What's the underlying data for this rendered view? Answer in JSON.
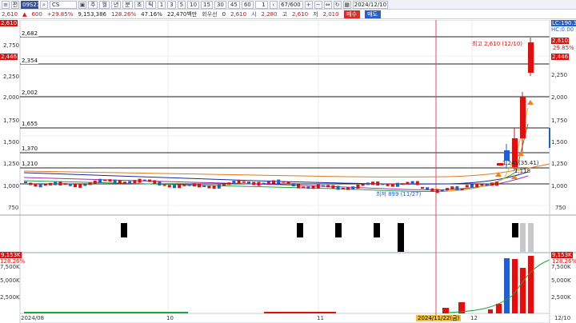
{
  "toolbar": {
    "code": "09S270",
    "name": "CS",
    "period_buttons": [
      "주",
      "월",
      "년",
      "분",
      "초",
      "틱"
    ],
    "interval_buttons": [
      "1",
      "3",
      "5",
      "10",
      "15",
      "30",
      "45",
      "60"
    ],
    "count_value": "1",
    "range_value": "67/600",
    "date_value": "2024/12/10"
  },
  "quote": {
    "price": "2,610",
    "change": "600",
    "change_pct": "+29.85%",
    "volume": "9,153,386",
    "vol_ratio": "128.26%",
    "turnover": "47.16%",
    "value_text": "22,470백만",
    "pref_label": "회우선",
    "pref_value": "0",
    "open_price": "2,610",
    "open_label": "시",
    "open_value": "2,280",
    "high_label": "고",
    "high_value": "2,610",
    "low_label": "저",
    "low_value": "2,010",
    "buy_label": "매수",
    "sell_label": "매도"
  },
  "price_levels": [
    "2,682",
    "2,354",
    "2,002",
    "1,655",
    "1,370",
    "1,210"
  ],
  "y_ticks": [
    "2,750",
    "2,500",
    "2,250",
    "2,000",
    "1,750",
    "1,500",
    "1,250",
    "1,000",
    "750"
  ],
  "volume_ticks": [
    "7,500K",
    "5,000K",
    "2,500K"
  ],
  "x_labels": [
    "2024/08",
    "10",
    "11",
    "12",
    "12/10"
  ],
  "marker_date": "2024/11/22(금)",
  "annotations": {
    "high": "최고 2,610 (12/10)",
    "low": "최저 899 (11/27)",
    "mid": "1,241(35.41)",
    "mid2": "1,118"
  },
  "right_badges": {
    "price": "2,610",
    "pct": "29.85%",
    "ma": "2,446",
    "lc": "LC:190.32",
    "hc": "HC:0.00",
    "vol": "9,153K",
    "vol_pct": "128.26%"
  },
  "colors": {
    "up": "#e01010",
    "down": "#1f5fd0",
    "buy": "#e02a2a",
    "sell": "#2f5fc6"
  }
}
